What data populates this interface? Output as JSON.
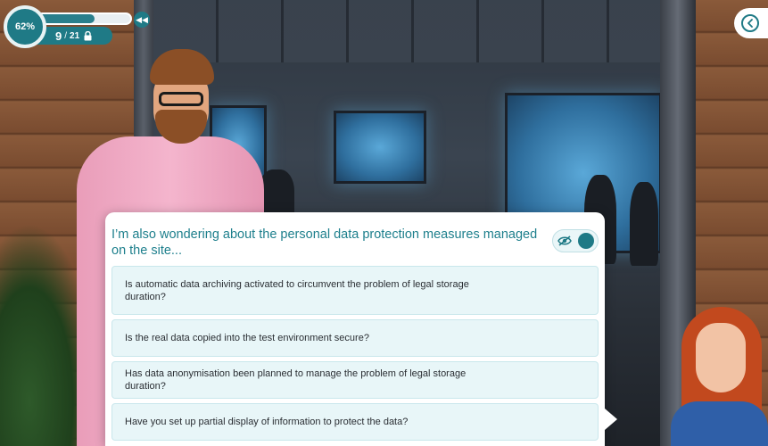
{
  "hud": {
    "progress_label": "62%",
    "progress_fraction": 0.62,
    "bar_fraction": 0.62,
    "counter_current": "9",
    "counter_separator": "/",
    "counter_total": "21",
    "lock_icon": "lock-icon",
    "rewind_icon": "rewind-icon"
  },
  "nav": {
    "back_icon": "chevron-left-icon"
  },
  "dialog": {
    "question": "I’m also wondering about the personal data protection measures managed on the site...",
    "toggle_icon": "eye-off-icon",
    "options": [
      {
        "text": "Is automatic data archiving activated to circumvent the problem of legal storage duration?"
      },
      {
        "text": "Is the real data copied into the test environment secure?"
      },
      {
        "text": "Has data anonymisation been planned to manage the problem of legal storage duration?"
      },
      {
        "text": "Have you set up partial display of information to protect the data?"
      }
    ]
  },
  "colors": {
    "accent": "#1f7a86",
    "title": "#1d7f8c",
    "option_bg": "#e8f6f8",
    "shirt": "#f4b5cd",
    "hair_woman": "#c2491e"
  }
}
